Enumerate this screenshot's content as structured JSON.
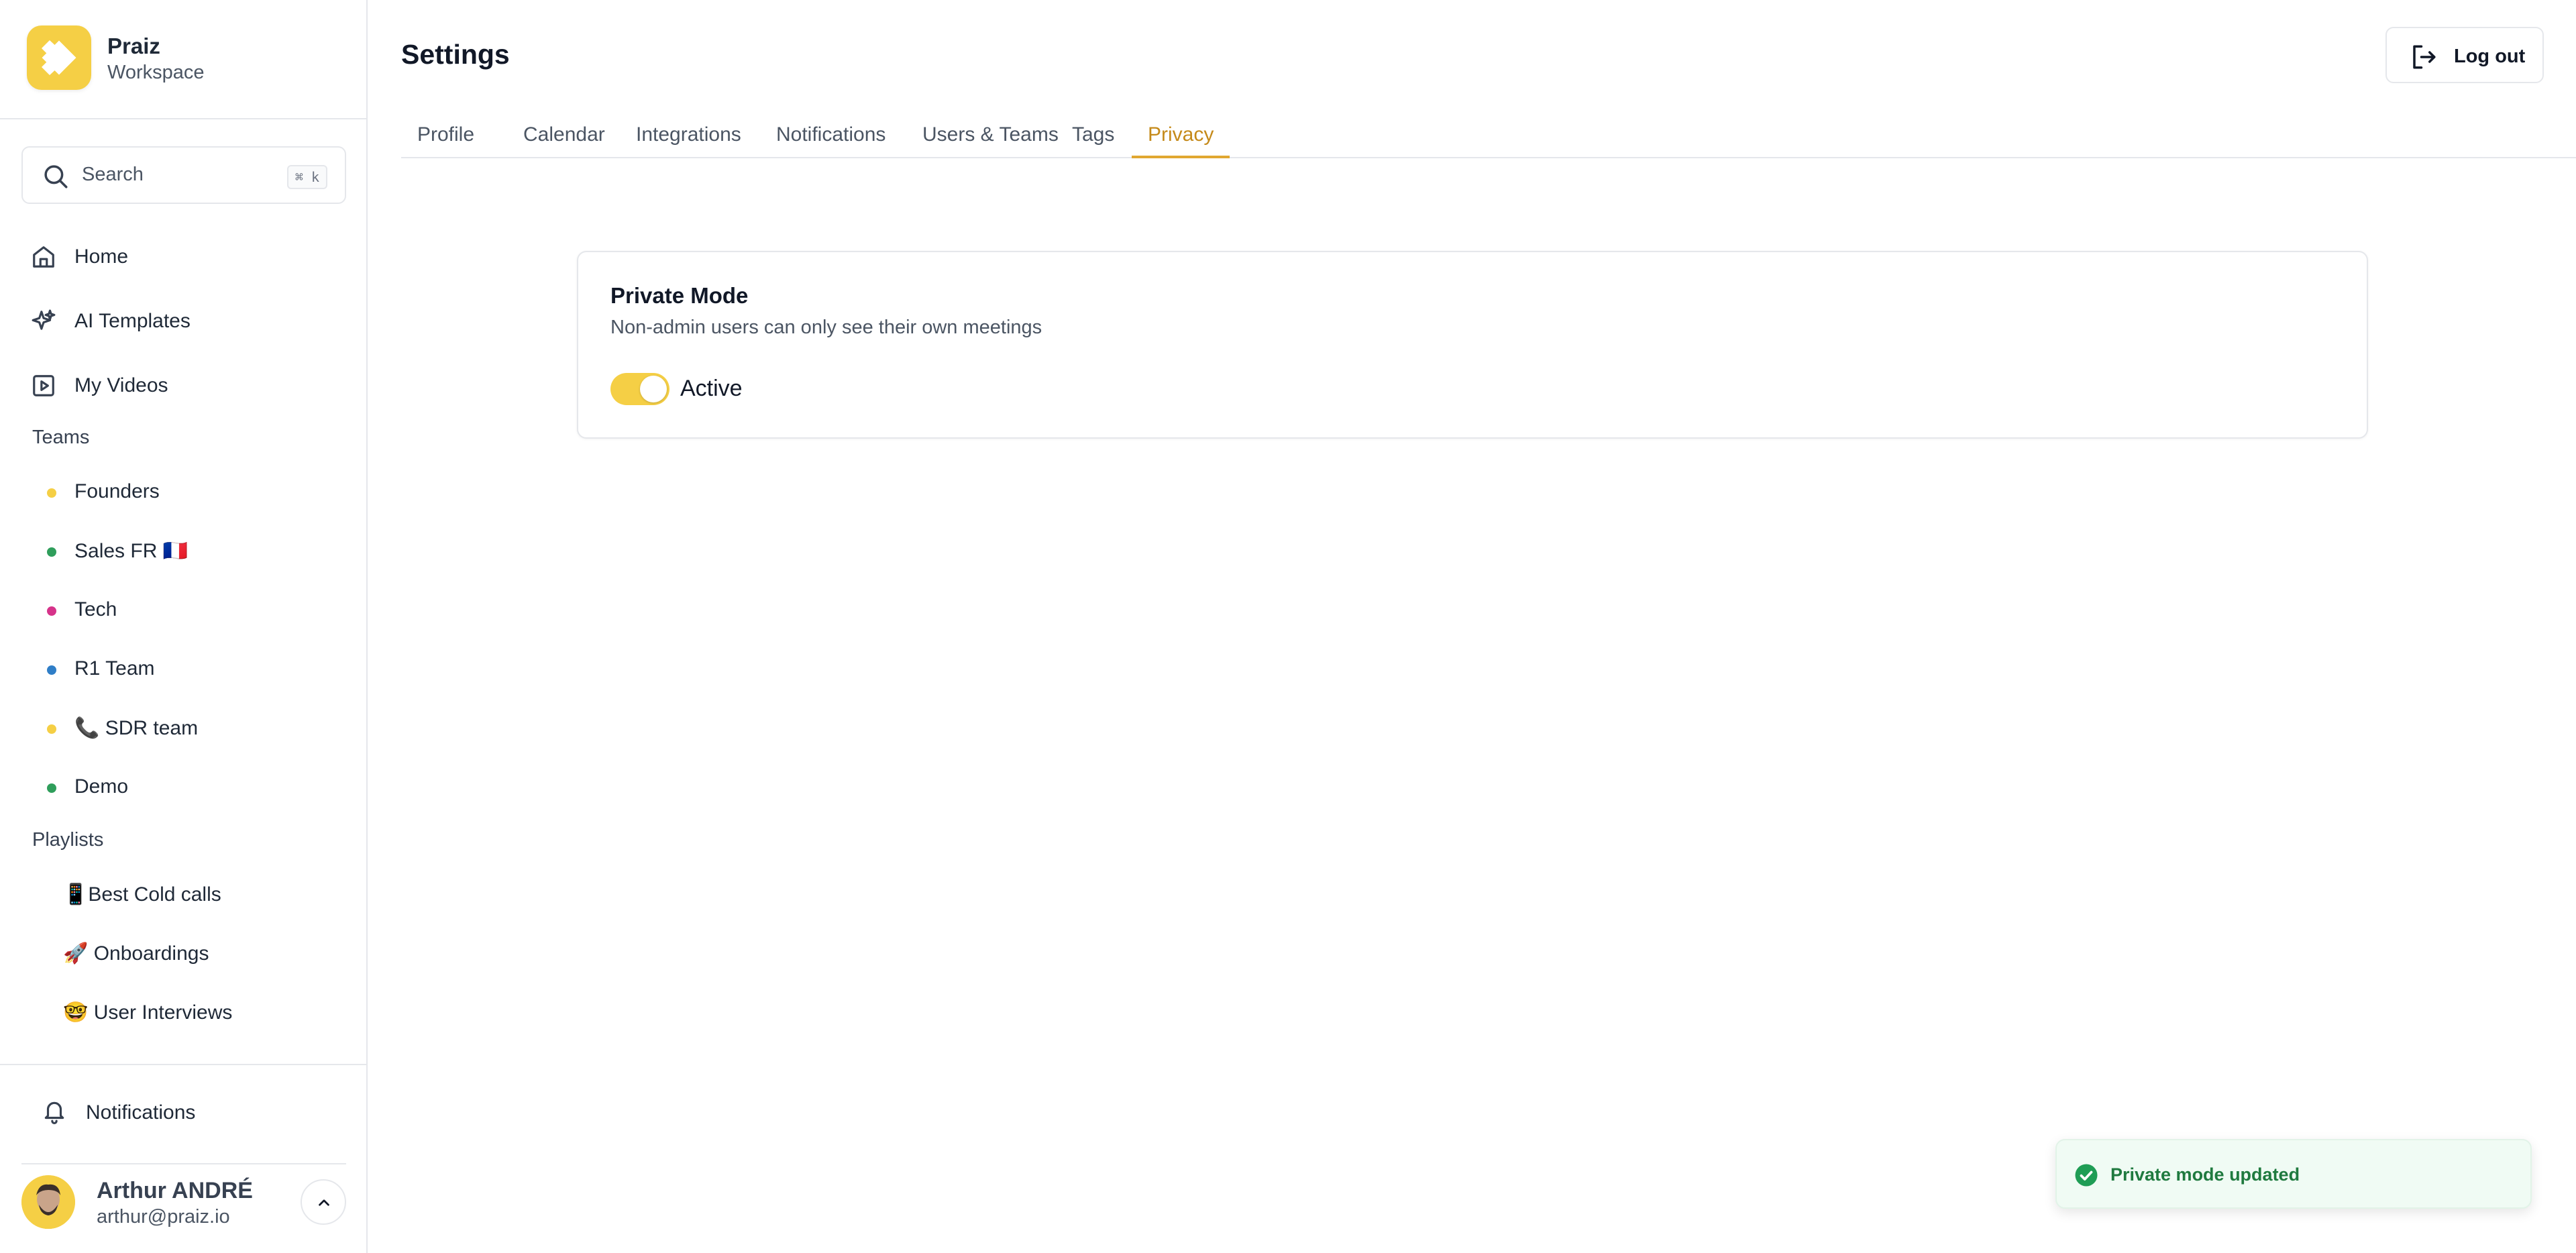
{
  "brand": {
    "name": "Praiz",
    "subtitle": "Workspace",
    "color": "#f5cf45"
  },
  "search": {
    "label": "Search",
    "shortcut": "⌘ k"
  },
  "nav": {
    "items": [
      {
        "label": "Home",
        "icon": "home-icon"
      },
      {
        "label": "AI Templates",
        "icon": "sparkles-icon"
      },
      {
        "label": "My Videos",
        "icon": "video-icon"
      }
    ]
  },
  "teams": {
    "title": "Teams",
    "items": [
      {
        "label": "Founders",
        "color": "#f5cf45"
      },
      {
        "label": "Sales FR 🇫🇷",
        "color": "#2f9e5b"
      },
      {
        "label": "Tech",
        "color": "#d6338a"
      },
      {
        "label": "R1 Team",
        "color": "#2f7ec7"
      },
      {
        "label": "📞 SDR team",
        "color": "#f5cf45"
      },
      {
        "label": "Demo",
        "color": "#2f9e5b"
      }
    ]
  },
  "playlists": {
    "title": "Playlists",
    "items": [
      {
        "label": "📱Best Cold calls"
      },
      {
        "label": "🚀 Onboardings"
      },
      {
        "label": "🤓 User Interviews"
      }
    ]
  },
  "sidebar_footer": {
    "notifications_label": "Notifications",
    "user_name": "Arthur ANDRÉ",
    "user_email": "arthur@praiz.io"
  },
  "header": {
    "title": "Settings",
    "logout_label": "Log out"
  },
  "tabs": {
    "items": [
      {
        "label": "Profile",
        "active": false
      },
      {
        "label": "Calendar",
        "active": false
      },
      {
        "label": "Integrations",
        "active": false
      },
      {
        "label": "Notifications",
        "active": false
      },
      {
        "label": "Users & Teams",
        "active": false
      },
      {
        "label": "Tags",
        "active": false
      },
      {
        "label": "Privacy",
        "active": true
      }
    ],
    "active_color": "#c58a1a"
  },
  "private_mode": {
    "title": "Private Mode",
    "description": "Non-admin users can only see their own meetings",
    "toggle_on": true,
    "toggle_label": "Active"
  },
  "toast": {
    "message": "Private mode updated",
    "color": "#1f9d55"
  }
}
